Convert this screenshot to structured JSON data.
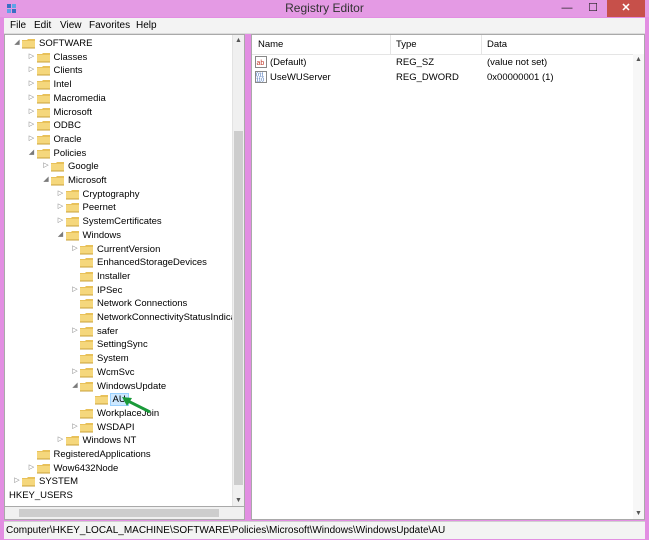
{
  "window": {
    "title": "Registry Editor",
    "controls": {
      "minimize": "—",
      "maximize": "☐",
      "close": "✕"
    }
  },
  "menu": [
    "File",
    "Edit",
    "View",
    "Favorites",
    "Help"
  ],
  "tree": [
    {
      "label": "SOFTWARE",
      "level": 0,
      "expander": "collapse"
    },
    {
      "label": "Classes",
      "level": 1,
      "expander": "expand"
    },
    {
      "label": "Clients",
      "level": 1,
      "expander": "expand"
    },
    {
      "label": "Intel",
      "level": 1,
      "expander": "expand"
    },
    {
      "label": "Macromedia",
      "level": 1,
      "expander": "expand"
    },
    {
      "label": "Microsoft",
      "level": 1,
      "expander": "expand"
    },
    {
      "label": "ODBC",
      "level": 1,
      "expander": "expand"
    },
    {
      "label": "Oracle",
      "level": 1,
      "expander": "expand"
    },
    {
      "label": "Policies",
      "level": 1,
      "expander": "collapse"
    },
    {
      "label": "Google",
      "level": 2,
      "expander": "expand"
    },
    {
      "label": "Microsoft",
      "level": 2,
      "expander": "collapse"
    },
    {
      "label": "Cryptography",
      "level": 3,
      "expander": "expand"
    },
    {
      "label": "Peernet",
      "level": 3,
      "expander": "expand"
    },
    {
      "label": "SystemCertificates",
      "level": 3,
      "expander": "expand"
    },
    {
      "label": "Windows",
      "level": 3,
      "expander": "collapse"
    },
    {
      "label": "CurrentVersion",
      "level": 4,
      "expander": "expand"
    },
    {
      "label": "EnhancedStorageDevices",
      "level": 4,
      "expander": "none"
    },
    {
      "label": "Installer",
      "level": 4,
      "expander": "none"
    },
    {
      "label": "IPSec",
      "level": 4,
      "expander": "expand"
    },
    {
      "label": "Network Connections",
      "level": 4,
      "expander": "none"
    },
    {
      "label": "NetworkConnectivityStatusIndicator",
      "level": 4,
      "expander": "none"
    },
    {
      "label": "safer",
      "level": 4,
      "expander": "expand"
    },
    {
      "label": "SettingSync",
      "level": 4,
      "expander": "none"
    },
    {
      "label": "System",
      "level": 4,
      "expander": "none"
    },
    {
      "label": "WcmSvc",
      "level": 4,
      "expander": "expand"
    },
    {
      "label": "WindowsUpdate",
      "level": 4,
      "expander": "collapse"
    },
    {
      "label": "AU",
      "level": 5,
      "expander": "none",
      "selected": true
    },
    {
      "label": "WorkplaceJoin",
      "level": 4,
      "expander": "none"
    },
    {
      "label": "WSDAPI",
      "level": 4,
      "expander": "expand"
    },
    {
      "label": "Windows NT",
      "level": 3,
      "expander": "expand"
    },
    {
      "label": "RegisteredApplications",
      "level": 1,
      "expander": "none"
    },
    {
      "label": "Wow6432Node",
      "level": 1,
      "expander": "expand"
    },
    {
      "label": "SYSTEM",
      "level": 0,
      "expander": "expand"
    },
    {
      "label": "HKEY_USERS",
      "level": -1,
      "expander": "none",
      "icon": "none"
    }
  ],
  "list": {
    "columns": [
      "Name",
      "Type",
      "Data"
    ],
    "rows": [
      {
        "name": "(Default)",
        "type": "REG_SZ",
        "data": "(value not set)",
        "icon": "string-value-icon"
      },
      {
        "name": "UseWUServer",
        "type": "REG_DWORD",
        "data": "0x00000001 (1)",
        "icon": "dword-value-icon"
      }
    ]
  },
  "status": "Computer\\HKEY_LOCAL_MACHINE\\SOFTWARE\\Policies\\Microsoft\\Windows\\WindowsUpdate\\AU",
  "colors": {
    "titlebar": "#e49ae4",
    "frame": "#e28ee2",
    "close": "#c7504a",
    "selection": "#cde8ff",
    "annotation_arrow": "#1a9a3a"
  }
}
